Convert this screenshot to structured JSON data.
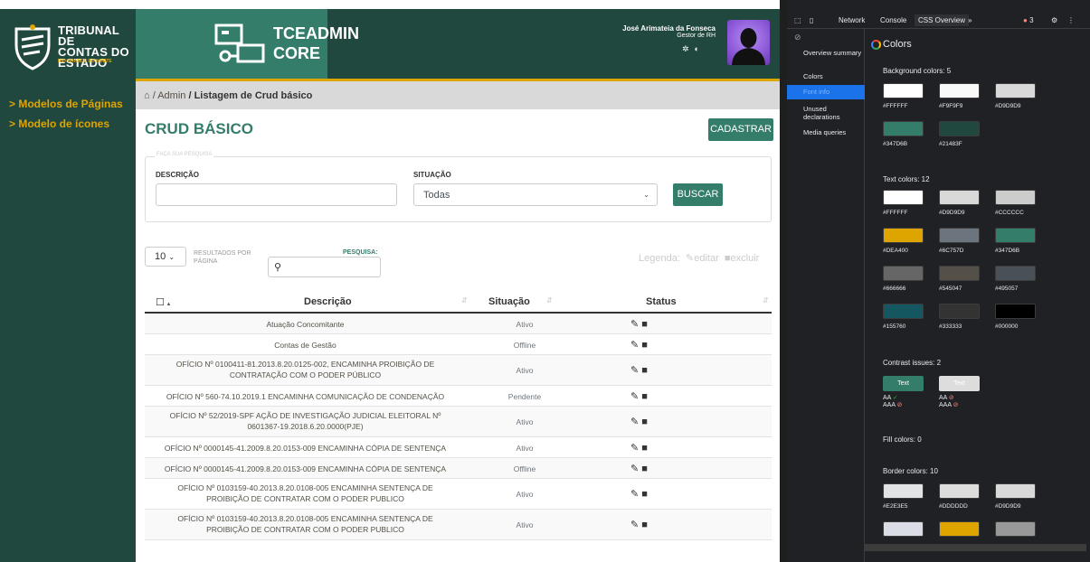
{
  "app": {
    "logo": {
      "line1": "TRIBUNAL DE",
      "line2": "CONTAS DO",
      "line3": "ESTADO",
      "sub": "RIO GRANDE DO NORTE"
    },
    "brand": {
      "line1": "TCEADMIN",
      "line2": "CORE"
    },
    "user": {
      "name": "José Arimateia da Fonseca",
      "role": "Gestor de RH"
    },
    "sidebar": {
      "items": [
        {
          "label": "> Modelos de Páginas"
        },
        {
          "label": "> Modelo de ícones"
        }
      ]
    },
    "breadcrumb": {
      "home_icon": "home-icon",
      "admin": "/ Admin",
      "current": "/ Listagem de Crud básico"
    },
    "page_title": "CRUD BÁSICO",
    "cadastrar_label": "CADASTRAR",
    "search": {
      "legend": "FAÇA SUA PESQUISA",
      "descricao_label": "DESCRIÇÃO",
      "situacao_label": "SITUAÇÃO",
      "situacao_value": "Todas",
      "buscar_label": "BUSCAR"
    },
    "list_controls": {
      "page_length": "10",
      "results_label_1": "RESULTADOS POR",
      "results_label_2": "PÁGINA",
      "pesquisa_label": "PESQUISA:",
      "legenda": "Legenda:",
      "editar": "editar",
      "excluir": "excluir"
    },
    "table": {
      "headers": {
        "descricao": "Descrição",
        "situacao": "Situação",
        "status": "Status"
      },
      "rows": [
        {
          "desc": [
            "Atuação Concomitante"
          ],
          "situacao": "Ativo"
        },
        {
          "desc": [
            "Contas de Gestão"
          ],
          "situacao": "Offline"
        },
        {
          "desc": [
            "OFÍCIO Nº 0100411-81.2013.8.20.0125-002, ENCAMINHA PROIBIÇÃO DE",
            "CONTRATAÇÃO COM O PODER PÚBLICO"
          ],
          "situacao": "Ativo"
        },
        {
          "desc": [
            "OFÍCIO Nº 560-74.10.2019.1 ENCAMINHA COMUNICAÇÃO DE CONDENAÇÃO"
          ],
          "situacao": "Pendente"
        },
        {
          "desc": [
            "OFÍCIO Nº 52/2019-SPF AÇÃO DE INVESTIGAÇÃO JUDICIAL ELEITORAL Nº",
            "0601367-19.2018.6.20.0000(PJE)"
          ],
          "situacao": "Ativo"
        },
        {
          "desc": [
            "OFÍCIO Nº 0000145-41.2009.8.20.0153-009 ENCAMINHA CÓPIA DE SENTENÇA"
          ],
          "situacao": "Ativo"
        },
        {
          "desc": [
            "OFÍCIO Nº 0000145-41.2009.8.20.0153-009 ENCAMINHA CÓPIA DE SENTENÇA"
          ],
          "situacao": "Offline"
        },
        {
          "desc": [
            "OFÍCIO Nº 0103159-40.2013.8.20.0108-005 ENCAMINHA SENTENÇA DE",
            "PROIBIÇÃO DE CONTRATAR COM O PODER PUBLICO"
          ],
          "situacao": "Ativo"
        },
        {
          "desc": [
            "OFÍCIO Nº 0103159-40.2013.8.20.0108-005 ENCAMINHA SENTENÇA DE",
            "PROIBIÇÃO DE CONTRATAR COM O PODER PUBLICO"
          ],
          "situacao": "Ativo"
        }
      ]
    }
  },
  "devtools": {
    "tabs": [
      "Network",
      "Console",
      "CSS Overview"
    ],
    "error_count": "3",
    "nav": [
      "Overview summary",
      "Colors",
      "Font info",
      "Unused declarations",
      "Media queries"
    ],
    "colors_title": "Colors",
    "background": {
      "title": "Background colors: 5",
      "colors": [
        "#FFFFFF",
        "#F9F9F9",
        "#D9D9D9",
        "#347D6B",
        "#21483F"
      ]
    },
    "text": {
      "title": "Text colors: 12",
      "colors": [
        "#FFFFFF",
        "#D9D9D9",
        "#CCCCCC",
        "#DEA400",
        "#6C757D",
        "#347D6B",
        "#666666",
        "#545047",
        "#495057",
        "#155760",
        "#333333",
        "#000000"
      ]
    },
    "contrast": {
      "title": "Contrast issues: 2",
      "items": [
        {
          "label": "Text",
          "bg": "#347D6B",
          "fg": "#FFFFFF"
        },
        {
          "label": "Text",
          "bg": "#DDDDDD",
          "fg": "#FFFFFF"
        }
      ]
    },
    "fill": {
      "title": "Fill colors: 0"
    },
    "border": {
      "title": "Border colors: 10",
      "colors": [
        "#E2E3E5",
        "#DDDDDD",
        "#D9D9D9"
      ],
      "extra_swatches": [
        "#DADDE6",
        "#DEA400",
        "#999999"
      ]
    }
  }
}
